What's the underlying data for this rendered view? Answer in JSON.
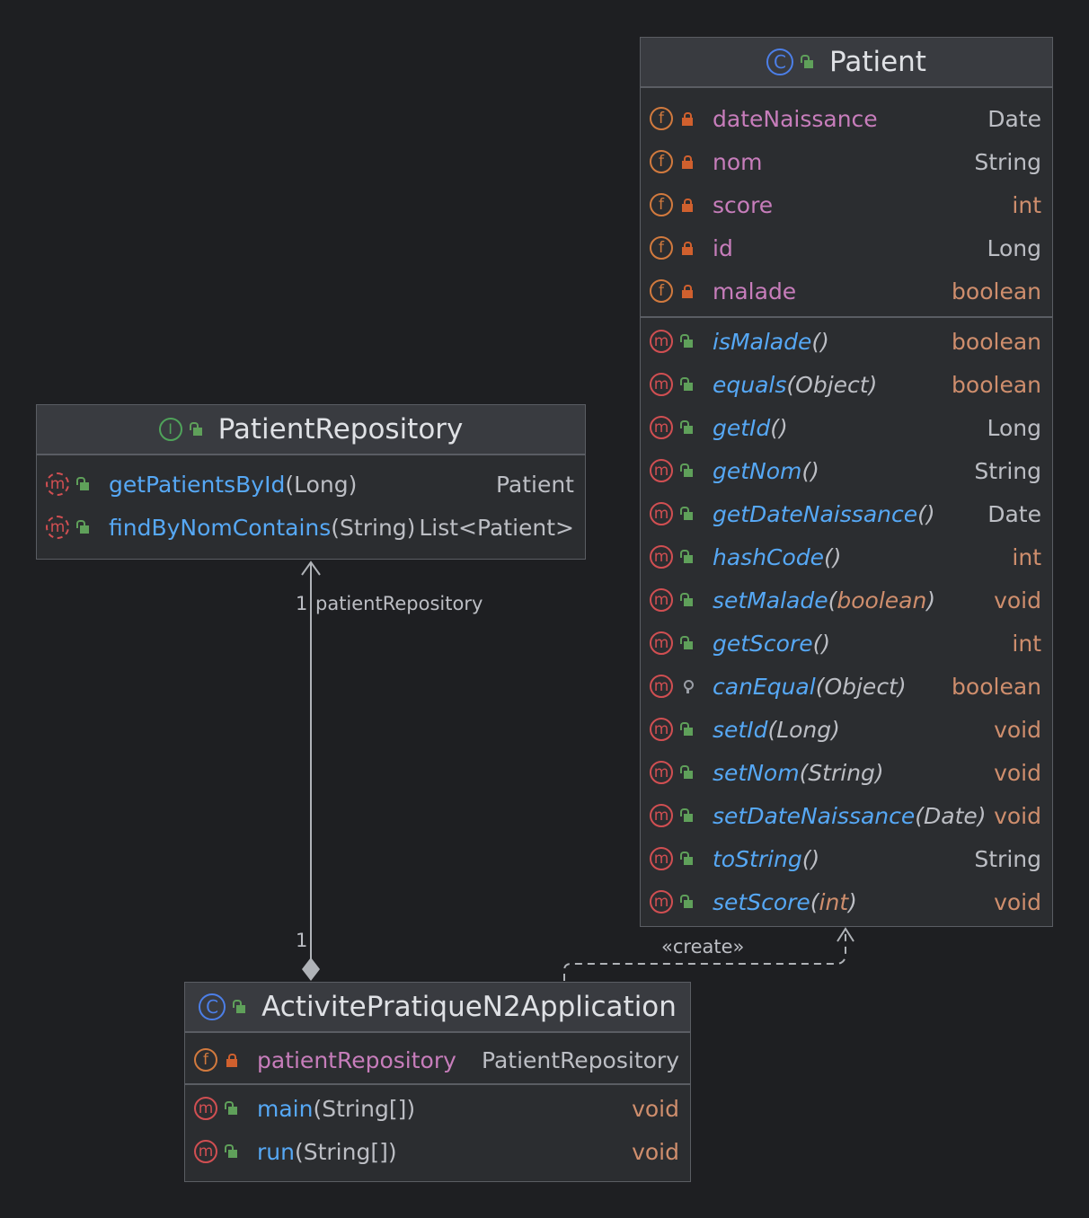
{
  "classes": {
    "patient": {
      "name": "Patient",
      "kind": "class",
      "fields": [
        {
          "name": "dateNaissance",
          "type": "Date",
          "visibility": "private"
        },
        {
          "name": "nom",
          "type": "String",
          "visibility": "private"
        },
        {
          "name": "score",
          "type": "int",
          "visibility": "private"
        },
        {
          "name": "id",
          "type": "Long",
          "visibility": "private"
        },
        {
          "name": "malade",
          "type": "boolean",
          "visibility": "private"
        }
      ],
      "methods": [
        {
          "name": "isMalade",
          "params": "()",
          "type": "boolean",
          "visibility": "public"
        },
        {
          "name": "equals",
          "params": "(Object)",
          "type": "boolean",
          "visibility": "public"
        },
        {
          "name": "getId",
          "params": "()",
          "type": "Long",
          "visibility": "public"
        },
        {
          "name": "getNom",
          "params": "()",
          "type": "String",
          "visibility": "public"
        },
        {
          "name": "getDateNaissance",
          "params": "()",
          "type": "Date",
          "visibility": "public"
        },
        {
          "name": "hashCode",
          "params": "()",
          "type": "int",
          "visibility": "public"
        },
        {
          "name": "setMalade",
          "params": "(boolean)",
          "type": "void",
          "visibility": "public"
        },
        {
          "name": "getScore",
          "params": "()",
          "type": "int",
          "visibility": "public"
        },
        {
          "name": "canEqual",
          "params": "(Object)",
          "type": "boolean",
          "visibility": "protected"
        },
        {
          "name": "setId",
          "params": "(Long)",
          "type": "void",
          "visibility": "public"
        },
        {
          "name": "setNom",
          "params": "(String)",
          "type": "void",
          "visibility": "public"
        },
        {
          "name": "setDateNaissance",
          "params": "(Date)",
          "type": "void",
          "visibility": "public"
        },
        {
          "name": "toString",
          "params": "()",
          "type": "String",
          "visibility": "public"
        },
        {
          "name": "setScore",
          "params": "(int)",
          "type": "void",
          "visibility": "public"
        }
      ]
    },
    "repository": {
      "name": "PatientRepository",
      "kind": "interface",
      "methods": [
        {
          "name": "getPatientsById",
          "params": "(Long)",
          "type": "Patient",
          "visibility": "public"
        },
        {
          "name": "findByNomContains",
          "params": "(String)",
          "type": "List<Patient>",
          "visibility": "public"
        }
      ]
    },
    "application": {
      "name": "ActivitePratiqueN2Application",
      "kind": "class",
      "fields": [
        {
          "name": "patientRepository",
          "type": "PatientRepository",
          "visibility": "private"
        }
      ],
      "methods": [
        {
          "name": "main",
          "params": "(String[])",
          "type": "void",
          "visibility": "public"
        },
        {
          "name": "run",
          "params": "(String[])",
          "type": "void",
          "visibility": "public"
        }
      ]
    }
  },
  "edges": {
    "composition": {
      "role": "patientRepository",
      "source_multiplicity": "1",
      "target_multiplicity": "1"
    },
    "dependency": {
      "stereotype": "«create»"
    }
  },
  "icons": {
    "field": "f",
    "method": "m",
    "class": "C",
    "interface": "I"
  },
  "colors": {
    "background": "#1e1f22",
    "field_name": "#c77dbb",
    "method_name": "#56a8f5",
    "keyword_type": "#cf8e6d",
    "text": "#bcbec4"
  }
}
